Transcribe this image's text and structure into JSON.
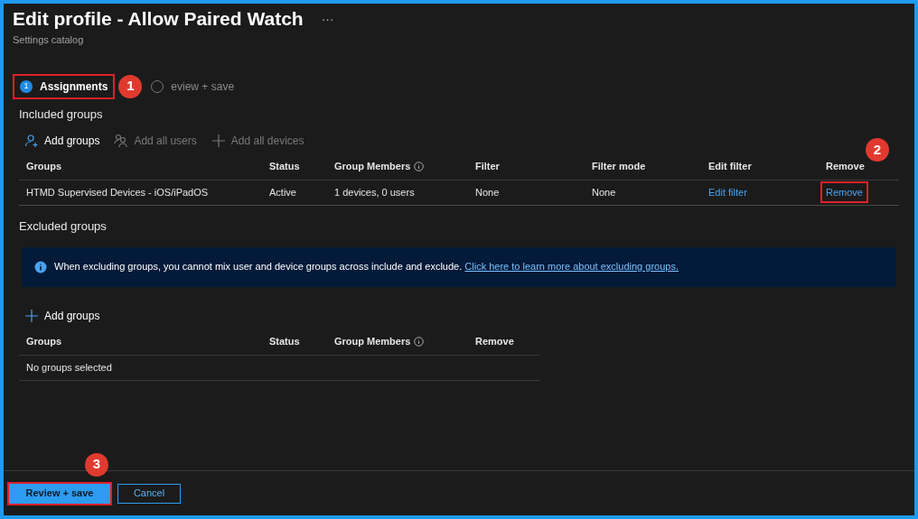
{
  "header": {
    "title": "Edit profile - Allow Paired Watch",
    "more": "···",
    "subtitle": "Settings catalog"
  },
  "tabs": [
    {
      "step": "1",
      "label": "Assignments",
      "selected": true,
      "highlighted": true,
      "callout": "1"
    },
    {
      "label": "eview + save",
      "selected": false,
      "highlighted": false
    }
  ],
  "included": {
    "heading": "Included groups",
    "actions": [
      {
        "kind": "user",
        "label": "Add groups",
        "disabled": false
      },
      {
        "kind": "users",
        "label": "Add all users",
        "disabled": true
      },
      {
        "kind": "plus",
        "label": "Add all devices",
        "disabled": true
      }
    ],
    "columns": [
      {
        "label": "Groups"
      },
      {
        "label": "Status"
      },
      {
        "label": "Group Members",
        "info": true
      },
      {
        "label": "Filter"
      },
      {
        "label": "Filter mode"
      },
      {
        "label": "Edit filter"
      },
      {
        "label": "Remove"
      }
    ],
    "rows": [
      {
        "cells": [
          {
            "kind": "text",
            "text": "HTMD Supervised Devices - iOS/iPadOS"
          },
          {
            "kind": "text",
            "text": "Active"
          },
          {
            "kind": "text",
            "text": "1 devices, 0 users"
          },
          {
            "kind": "text",
            "text": "None"
          },
          {
            "kind": "text",
            "text": "None"
          },
          {
            "kind": "link",
            "text": "Edit filter",
            "highlighted": false
          },
          {
            "kind": "link",
            "text": "Remove",
            "highlighted": true,
            "callout": "2"
          }
        ]
      }
    ]
  },
  "excluded": {
    "heading": "Excluded groups",
    "notice": {
      "text": "When excluding groups, you cannot mix user and device groups across include and exclude.",
      "link": "Click here to learn more about excluding groups."
    },
    "actions": [
      {
        "kind": "plus",
        "label": "Add groups",
        "disabled": false
      }
    ],
    "columns": [
      {
        "label": "Groups"
      },
      {
        "label": "Status"
      },
      {
        "label": "Group Members",
        "info": true
      },
      {
        "label": "Remove"
      }
    ],
    "empty": "No groups selected"
  },
  "footer": {
    "buttons": [
      {
        "kind": "primary",
        "label": "Review + save",
        "highlighted": true,
        "callout": "3"
      },
      {
        "kind": "secondary",
        "label": "Cancel",
        "highlighted": false
      }
    ]
  }
}
